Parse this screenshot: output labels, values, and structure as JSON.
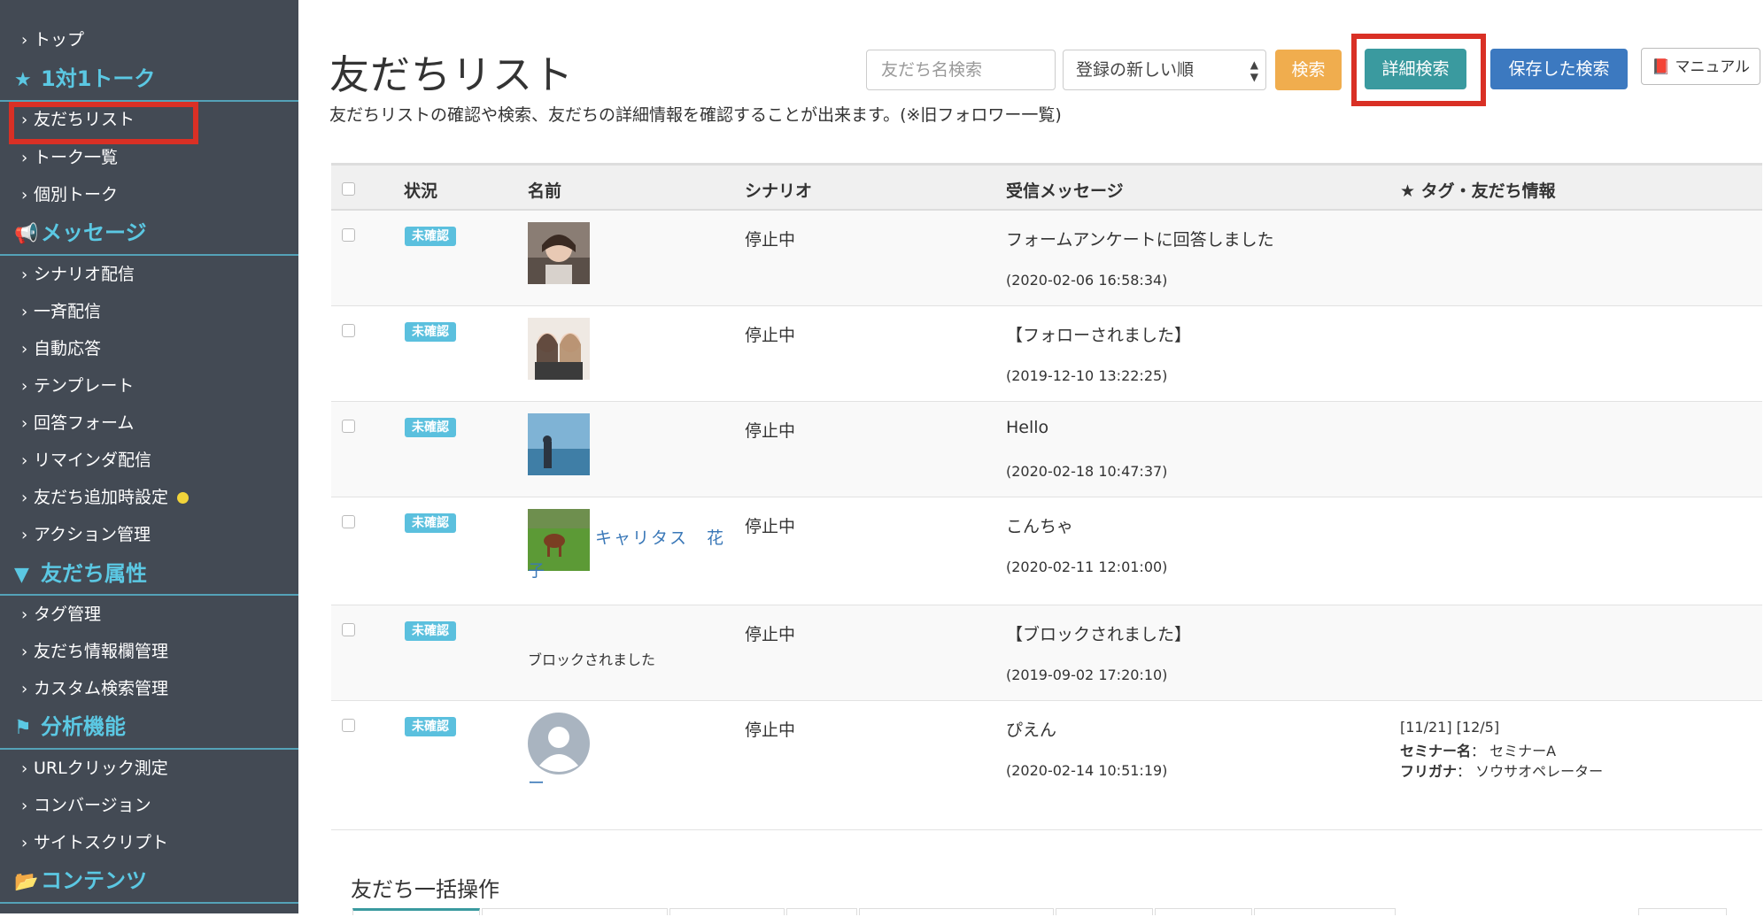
{
  "sidebar": {
    "top": "トップ",
    "section_talk": "1対1トーク",
    "talk_items": [
      "友だちリスト",
      "トーク一覧",
      "個別トーク"
    ],
    "section_message": "メッセージ",
    "message_items": [
      "シナリオ配信",
      "一斉配信",
      "自動応答",
      "テンプレート",
      "回答フォーム",
      "リマインダ配信",
      "友だち追加時設定",
      "アクション管理"
    ],
    "section_attr": "友だち属性",
    "attr_items": [
      "タグ管理",
      "友だち情報欄管理",
      "カスタム検索管理"
    ],
    "section_analysis": "分析機能",
    "analysis_items": [
      "URLクリック測定",
      "コンバージョン",
      "サイトスクリプト"
    ],
    "section_contents": "コンテンツ",
    "active_item": "友だちリスト"
  },
  "header": {
    "title": "友だちリスト",
    "description": "友だちリストの確認や検索、友だちの詳細情報を確認することが出来ます。(※旧フォロワー一覧)",
    "search_placeholder": "友だち名検索",
    "sort_selected": "登録の新しい順",
    "search_button": "検索",
    "detail_search_button": "詳細検索",
    "saved_search_button": "保存した検索",
    "manual_button": "マニュアル"
  },
  "table": {
    "columns": {
      "status": "状況",
      "name": "名前",
      "scenario": "シナリオ",
      "message": "受信メッセージ",
      "tags": "★ タグ・友だち情報"
    },
    "rows": [
      {
        "status": "未確認",
        "name": "",
        "scenario": "停止中",
        "message": "フォームアンケートに回答しました",
        "time": "(2020-02-06 16:58:34)"
      },
      {
        "status": "未確認",
        "name": "",
        "scenario": "停止中",
        "message": "【フォローされました】",
        "time": "(2019-12-10 13:22:25)"
      },
      {
        "status": "未確認",
        "name": "",
        "scenario": "停止中",
        "message": "Hello",
        "time": "(2020-02-18 10:47:37)"
      },
      {
        "status": "未確認",
        "name_line1": "キャリタス　花",
        "name_line2": "子",
        "scenario": "停止中",
        "message": "こんちゃ",
        "time": "(2020-02-11 12:01:00)"
      },
      {
        "status": "未確認",
        "name": "ブロックされました",
        "scenario": "停止中",
        "message": "【ブロックされました】",
        "time": "(2019-09-02 17:20:10)"
      },
      {
        "status": "未確認",
        "name": "ー",
        "scenario": "停止中",
        "message": "ぴえん",
        "time": "(2020-02-14 10:51:19)",
        "tags": "[11/21] [12/5]",
        "fields": [
          {
            "label": "セミナー名",
            "value": "セミナーA"
          },
          {
            "label": "フリガナ",
            "value": "ソウサオペレーター"
          }
        ]
      }
    ]
  },
  "bulk": {
    "title": "友だち一括操作"
  },
  "colors": {
    "sidebar_bg": "#434a54",
    "sidebar_accent": "#5bc8e3",
    "highlight_red": "#d93025",
    "badge": "#5bc0de",
    "btn_search": "#f0ad4e",
    "btn_detail": "#3a9a9f",
    "btn_saved": "#3c79c0",
    "link": "#3a78b8"
  }
}
